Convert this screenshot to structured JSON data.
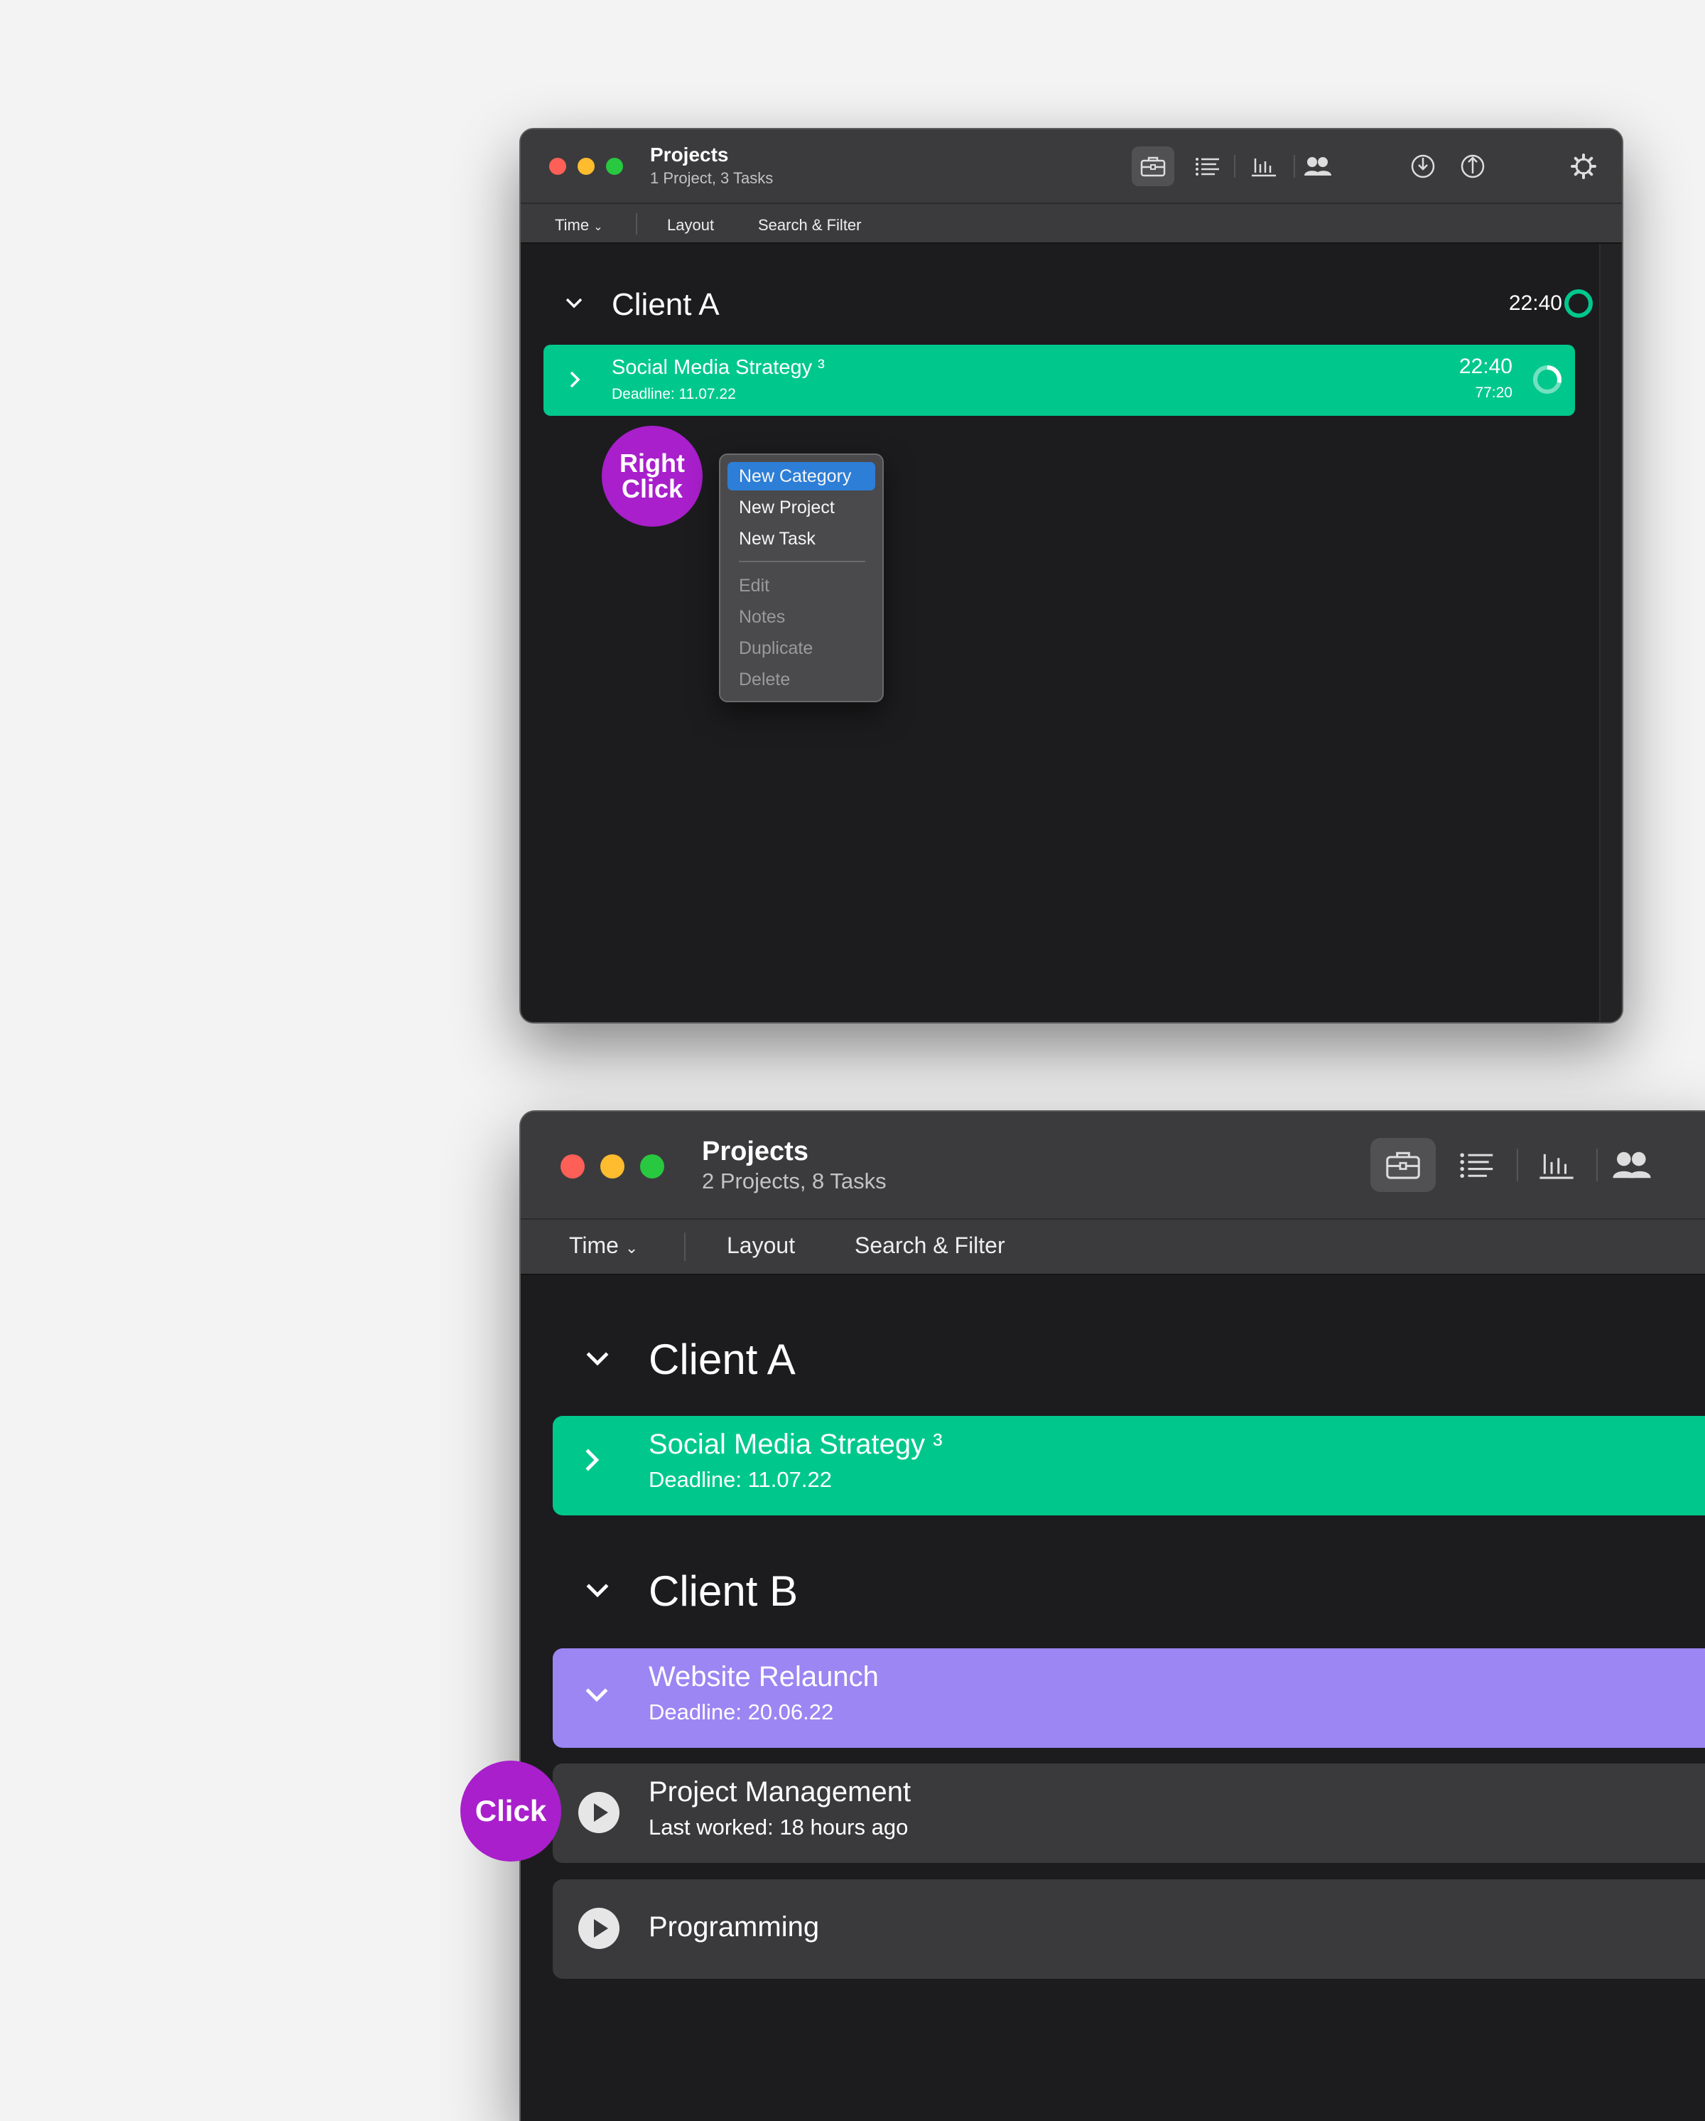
{
  "colors": {
    "background": "#f3f3f3",
    "window_bg": "#1c1c1e",
    "titlebar_bg": "#3b3b3d",
    "accent_green": "#00c88d",
    "accent_purple": "#9b86f3",
    "badge_purple": "#a81fcb",
    "menu_highlight": "#2d7ed7",
    "task_row_bg": "#3a3a3c"
  },
  "window1": {
    "title": "Projects",
    "subtitle": "1 Project, 3 Tasks",
    "toolbar_icons": [
      "briefcase-icon",
      "list-icon",
      "bar-chart-icon",
      "people-icon",
      "import-icon",
      "export-icon",
      "gear-icon"
    ],
    "menu": {
      "time": "Time",
      "layout": "Layout",
      "search_filter": "Search & Filter"
    },
    "category": {
      "name": "Client A",
      "time": "22:40"
    },
    "project": {
      "name": "Social Media Strategy ³",
      "deadline": "Deadline: 11.07.22",
      "time": "22:40",
      "budget": "77:20",
      "progress": 0.29
    },
    "right_click_label": "Right Click",
    "context_menu": {
      "enabled": [
        "New Category",
        "New Project",
        "New Task"
      ],
      "disabled": [
        "Edit",
        "Notes",
        "Duplicate",
        "Delete"
      ],
      "highlighted": "New Category"
    }
  },
  "window2": {
    "title": "Projects",
    "subtitle": "2 Projects, 8 Tasks",
    "menu": {
      "time": "Time",
      "layout": "Layout",
      "search_filter": "Search & Filter"
    },
    "categories": [
      {
        "name": "Client A",
        "projects": [
          {
            "name": "Social Media Strategy ³",
            "sub": "Deadline: 11.07.22"
          }
        ]
      },
      {
        "name": "Client B",
        "projects": [
          {
            "name": "Website Relaunch",
            "sub": "Deadline: 20.06.22"
          }
        ],
        "tasks": [
          {
            "name": "Project Management",
            "sub": "Last worked: 18 hours ago"
          },
          {
            "name": "Programming",
            "sub": ""
          }
        ]
      }
    ],
    "click_label": "Click"
  }
}
